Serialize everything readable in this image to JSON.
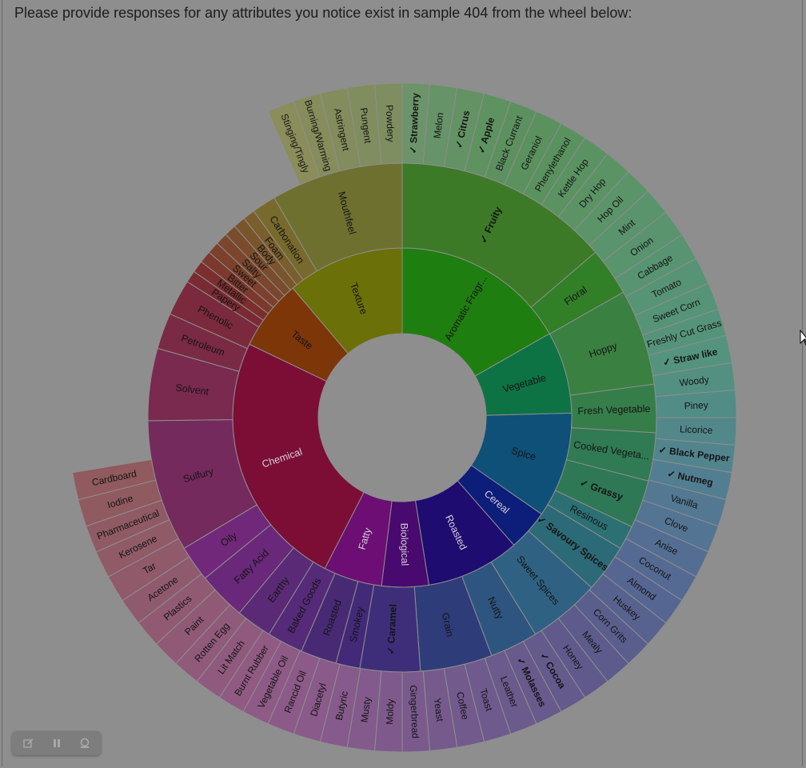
{
  "prompt": {
    "text": "Please provide responses for any attributes you notice exist in sample 404 from the wheel below:"
  },
  "chart_data": {
    "type": "sunburst",
    "center_hole": true,
    "rings": [
      [
        {
          "label": "Aromatic Fragr...",
          "value": 30,
          "color": "#1f7e10"
        },
        {
          "label": "Vegetable",
          "value": 14,
          "color": "#0d7345"
        },
        {
          "label": "Spice",
          "value": 18,
          "color": "#0e5077"
        },
        {
          "label": "Cereal",
          "value": 7,
          "color": "#0d1d7a"
        },
        {
          "label": "Roasted",
          "value": 16,
          "color": "#1e0c70"
        },
        {
          "label": "Biological",
          "value": 8,
          "color": "#480a6e"
        },
        {
          "label": "Fatty",
          "value": 10,
          "color": "#6c0e73"
        },
        {
          "label": "Chemical",
          "value": 44,
          "color": "#7c0e36"
        },
        {
          "label": "Taste",
          "value": 12,
          "color": "#7c3608"
        },
        {
          "label": "Texture",
          "value": 20,
          "color": "#6b7009"
        }
      ],
      [
        {
          "label": "✓ Fruity",
          "value": 18,
          "color": "#3d7a28",
          "bold": true
        },
        {
          "label": "Floral",
          "value": 4,
          "color": "#317f27"
        },
        {
          "label": "Hoppy",
          "value": 8,
          "color": "#3a8040"
        },
        {
          "label": "Fresh Vegetable",
          "value": 4,
          "color": "#357e4a"
        },
        {
          "label": "Cooked Vegeta...",
          "value": 4,
          "color": "#307a54"
        },
        {
          "label": "✓ Grassy",
          "value": 4,
          "color": "#2e7856",
          "bold": true
        },
        {
          "label": "Resinous",
          "value": 2,
          "color": "#2c7074"
        },
        {
          "label": "✓ Savoury Spices",
          "value": 4,
          "color": "#2c6a78",
          "bold": true
        },
        {
          "label": "Sweet Spices",
          "value": 6,
          "color": "#2f6282"
        },
        {
          "label": "Nutty",
          "value": 4,
          "color": "#2e5480"
        },
        {
          "label": "Grain",
          "value": 6,
          "color": "#2f3c7a"
        },
        {
          "label": "✓ Caramel",
          "value": 5,
          "color": "#3e2e7a",
          "bold": true
        },
        {
          "label": "Smokey",
          "value": 2,
          "color": "#422a78"
        },
        {
          "label": "Roasted",
          "value": 3,
          "color": "#482a74"
        },
        {
          "label": "Baked Goods",
          "value": 3,
          "color": "#552a78"
        },
        {
          "label": "Earthy",
          "value": 3,
          "color": "#5b2a76"
        },
        {
          "label": "Fatty Acid",
          "value": 4,
          "color": "#69287a"
        },
        {
          "label": "Oily",
          "value": 3,
          "color": "#72287a"
        },
        {
          "label": "Sulfury",
          "value": 11,
          "color": "#752a5e"
        },
        {
          "label": "Solvent",
          "value": 6,
          "color": "#7a2a4e"
        },
        {
          "label": "Petroleum",
          "value": 3,
          "color": "#7a2a44"
        },
        {
          "label": "Phenolic",
          "value": 3,
          "color": "#7a2a3c"
        },
        {
          "label": "Papery",
          "value": 1,
          "color": "#7a2a33"
        },
        {
          "label": "Metallic",
          "value": 1,
          "color": "#7c2e2c"
        },
        {
          "label": "Bitter",
          "value": 1,
          "color": "#7c382c"
        },
        {
          "label": "Sweet",
          "value": 1,
          "color": "#7c402c"
        },
        {
          "label": "Salty",
          "value": 1,
          "color": "#7c462c"
        },
        {
          "label": "Sour",
          "value": 1,
          "color": "#7a4c2c"
        },
        {
          "label": "Body",
          "value": 1,
          "color": "#7a552c"
        },
        {
          "label": "Foam",
          "value": 1,
          "color": "#7a5e2c"
        },
        {
          "label": "Carbonation",
          "value": 2,
          "color": "#786a2c"
        },
        {
          "label": "Mouthfeel",
          "value": 11,
          "color": "#6e7030"
        }
      ],
      [
        {
          "label": "✓ Strawberry",
          "value": 1,
          "color": "#6b946a",
          "bold": true
        },
        {
          "label": "Melon",
          "value": 1,
          "color": "#669367"
        },
        {
          "label": "✓ Citrus",
          "value": 1,
          "color": "#639264",
          "bold": true
        },
        {
          "label": "✓ Apple",
          "value": 1,
          "color": "#5f9261",
          "bold": true
        },
        {
          "label": "Black Currant",
          "value": 1,
          "color": "#5c915f"
        },
        {
          "label": "Geraniol",
          "value": 1,
          "color": "#5a915e"
        },
        {
          "label": "Phenylethanol",
          "value": 1,
          "color": "#5a925f"
        },
        {
          "label": "Kettle Hop",
          "value": 1,
          "color": "#5b9262"
        },
        {
          "label": "Dry Hop",
          "value": 1,
          "color": "#5c9365"
        },
        {
          "label": "Hop Oil",
          "value": 1,
          "color": "#5b9468"
        },
        {
          "label": "Mint",
          "value": 1,
          "color": "#5a946c"
        },
        {
          "label": "Onion",
          "value": 1,
          "color": "#59946f"
        },
        {
          "label": "Cabbage",
          "value": 1,
          "color": "#589472"
        },
        {
          "label": "Tomato",
          "value": 1,
          "color": "#579475"
        },
        {
          "label": "Sweet Corn",
          "value": 1,
          "color": "#569478"
        },
        {
          "label": "Freshly Cut Grass",
          "value": 1,
          "color": "#55947b"
        },
        {
          "label": "✓ Straw like",
          "value": 1,
          "color": "#54947e",
          "bold": true
        },
        {
          "label": "Woody",
          "value": 1,
          "color": "#539081"
        },
        {
          "label": "Piney",
          "value": 1,
          "color": "#528c86"
        },
        {
          "label": "Licorice",
          "value": 1,
          "color": "#52888a"
        },
        {
          "label": "✓ Black Pepper",
          "value": 1,
          "color": "#52848e",
          "bold": true
        },
        {
          "label": "✓ Nutmeg",
          "value": 1,
          "color": "#527e91",
          "bold": true
        },
        {
          "label": "Vanilla",
          "value": 1,
          "color": "#537892"
        },
        {
          "label": "Clove",
          "value": 1,
          "color": "#537493"
        },
        {
          "label": "Anise",
          "value": 1,
          "color": "#546e93"
        },
        {
          "label": "Coconut",
          "value": 1,
          "color": "#556a93"
        },
        {
          "label": "Almond",
          "value": 1,
          "color": "#566692"
        },
        {
          "label": "Huskey",
          "value": 1,
          "color": "#58628f"
        },
        {
          "label": "Corn Grits",
          "value": 1,
          "color": "#5a5e8d"
        },
        {
          "label": "Mealy",
          "value": 1,
          "color": "#5c5b8c"
        },
        {
          "label": "Honey",
          "value": 1,
          "color": "#605a8c"
        },
        {
          "label": "✓ Cocoa",
          "value": 1,
          "color": "#645a8c",
          "bold": true
        },
        {
          "label": "✓ Molasses",
          "value": 1,
          "color": "#685a8c",
          "bold": true
        },
        {
          "label": "Leather",
          "value": 1,
          "color": "#6b5a8c"
        },
        {
          "label": "Toast",
          "value": 1,
          "color": "#6e5a8c"
        },
        {
          "label": "Coffee",
          "value": 1,
          "color": "#725a8c"
        },
        {
          "label": "Yeast",
          "value": 1,
          "color": "#765a8c"
        },
        {
          "label": "Gingerbread",
          "value": 1,
          "color": "#7a5a8c"
        },
        {
          "label": "Moldy",
          "value": 1,
          "color": "#7e5a8c"
        },
        {
          "label": "Musty",
          "value": 1,
          "color": "#825a8c"
        },
        {
          "label": "Butyric",
          "value": 1,
          "color": "#865a8b"
        },
        {
          "label": "Diacetyl",
          "value": 1,
          "color": "#895a8a"
        },
        {
          "label": "Rancid Oil",
          "value": 1,
          "color": "#8c5a88"
        },
        {
          "label": "Vegetable Oil",
          "value": 1,
          "color": "#8e5a86"
        },
        {
          "label": "Burnt Rubber",
          "value": 1,
          "color": "#905a82"
        },
        {
          "label": "Lit Match",
          "value": 1,
          "color": "#905a7e"
        },
        {
          "label": "Rotten Egg",
          "value": 1,
          "color": "#905a7a"
        },
        {
          "label": "Paint",
          "value": 1,
          "color": "#905a76"
        },
        {
          "label": "Plastics",
          "value": 1,
          "color": "#905a72"
        },
        {
          "label": "Acetone",
          "value": 1,
          "color": "#905a6e"
        },
        {
          "label": "Tar",
          "value": 1,
          "color": "#905a6a"
        },
        {
          "label": "Kerosene",
          "value": 1,
          "color": "#905a67"
        },
        {
          "label": "Pharmaceutical",
          "value": 1,
          "color": "#905a64"
        },
        {
          "label": "Iodine",
          "value": 1,
          "color": "#905a61"
        },
        {
          "label": "Cardboard",
          "value": 1,
          "color": "#905a5e"
        },
        {
          "label": "gap",
          "value": 16,
          "color": null
        },
        {
          "label": "Stinging/Tingly",
          "value": 1,
          "color": "#8b8d5a"
        },
        {
          "label": "Burning/Warming",
          "value": 1,
          "color": "#878c5b"
        },
        {
          "label": "Astringent",
          "value": 1,
          "color": "#838c5c"
        },
        {
          "label": "Pungent",
          "value": 1,
          "color": "#808d5e"
        },
        {
          "label": "Powdery",
          "value": 1,
          "color": "#7e8e61"
        }
      ]
    ]
  },
  "toolbar": {
    "icons": [
      "edit-icon",
      "pause-icon",
      "settings-icon"
    ]
  }
}
